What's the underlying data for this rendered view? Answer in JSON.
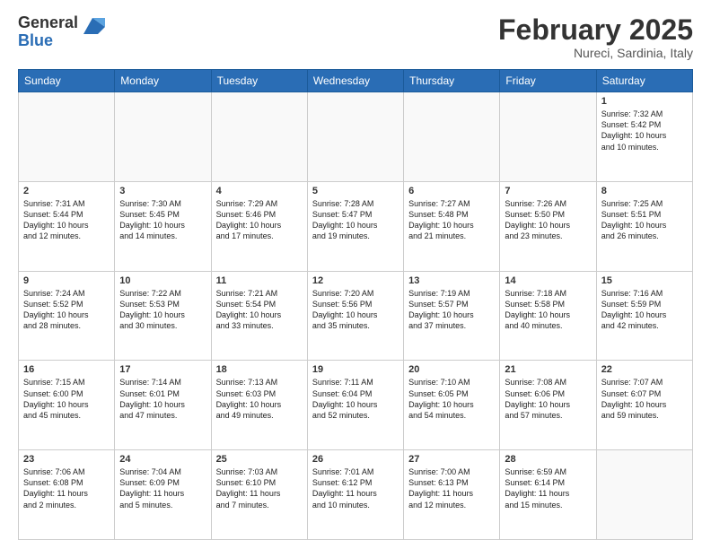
{
  "header": {
    "logo_general": "General",
    "logo_blue": "Blue",
    "month_title": "February 2025",
    "location": "Nureci, Sardinia, Italy"
  },
  "weekdays": [
    "Sunday",
    "Monday",
    "Tuesday",
    "Wednesday",
    "Thursday",
    "Friday",
    "Saturday"
  ],
  "weeks": [
    [
      {
        "day": "",
        "info": ""
      },
      {
        "day": "",
        "info": ""
      },
      {
        "day": "",
        "info": ""
      },
      {
        "day": "",
        "info": ""
      },
      {
        "day": "",
        "info": ""
      },
      {
        "day": "",
        "info": ""
      },
      {
        "day": "1",
        "info": "Sunrise: 7:32 AM\nSunset: 5:42 PM\nDaylight: 10 hours\nand 10 minutes."
      }
    ],
    [
      {
        "day": "2",
        "info": "Sunrise: 7:31 AM\nSunset: 5:44 PM\nDaylight: 10 hours\nand 12 minutes."
      },
      {
        "day": "3",
        "info": "Sunrise: 7:30 AM\nSunset: 5:45 PM\nDaylight: 10 hours\nand 14 minutes."
      },
      {
        "day": "4",
        "info": "Sunrise: 7:29 AM\nSunset: 5:46 PM\nDaylight: 10 hours\nand 17 minutes."
      },
      {
        "day": "5",
        "info": "Sunrise: 7:28 AM\nSunset: 5:47 PM\nDaylight: 10 hours\nand 19 minutes."
      },
      {
        "day": "6",
        "info": "Sunrise: 7:27 AM\nSunset: 5:48 PM\nDaylight: 10 hours\nand 21 minutes."
      },
      {
        "day": "7",
        "info": "Sunrise: 7:26 AM\nSunset: 5:50 PM\nDaylight: 10 hours\nand 23 minutes."
      },
      {
        "day": "8",
        "info": "Sunrise: 7:25 AM\nSunset: 5:51 PM\nDaylight: 10 hours\nand 26 minutes."
      }
    ],
    [
      {
        "day": "9",
        "info": "Sunrise: 7:24 AM\nSunset: 5:52 PM\nDaylight: 10 hours\nand 28 minutes."
      },
      {
        "day": "10",
        "info": "Sunrise: 7:22 AM\nSunset: 5:53 PM\nDaylight: 10 hours\nand 30 minutes."
      },
      {
        "day": "11",
        "info": "Sunrise: 7:21 AM\nSunset: 5:54 PM\nDaylight: 10 hours\nand 33 minutes."
      },
      {
        "day": "12",
        "info": "Sunrise: 7:20 AM\nSunset: 5:56 PM\nDaylight: 10 hours\nand 35 minutes."
      },
      {
        "day": "13",
        "info": "Sunrise: 7:19 AM\nSunset: 5:57 PM\nDaylight: 10 hours\nand 37 minutes."
      },
      {
        "day": "14",
        "info": "Sunrise: 7:18 AM\nSunset: 5:58 PM\nDaylight: 10 hours\nand 40 minutes."
      },
      {
        "day": "15",
        "info": "Sunrise: 7:16 AM\nSunset: 5:59 PM\nDaylight: 10 hours\nand 42 minutes."
      }
    ],
    [
      {
        "day": "16",
        "info": "Sunrise: 7:15 AM\nSunset: 6:00 PM\nDaylight: 10 hours\nand 45 minutes."
      },
      {
        "day": "17",
        "info": "Sunrise: 7:14 AM\nSunset: 6:01 PM\nDaylight: 10 hours\nand 47 minutes."
      },
      {
        "day": "18",
        "info": "Sunrise: 7:13 AM\nSunset: 6:03 PM\nDaylight: 10 hours\nand 49 minutes."
      },
      {
        "day": "19",
        "info": "Sunrise: 7:11 AM\nSunset: 6:04 PM\nDaylight: 10 hours\nand 52 minutes."
      },
      {
        "day": "20",
        "info": "Sunrise: 7:10 AM\nSunset: 6:05 PM\nDaylight: 10 hours\nand 54 minutes."
      },
      {
        "day": "21",
        "info": "Sunrise: 7:08 AM\nSunset: 6:06 PM\nDaylight: 10 hours\nand 57 minutes."
      },
      {
        "day": "22",
        "info": "Sunrise: 7:07 AM\nSunset: 6:07 PM\nDaylight: 10 hours\nand 59 minutes."
      }
    ],
    [
      {
        "day": "23",
        "info": "Sunrise: 7:06 AM\nSunset: 6:08 PM\nDaylight: 11 hours\nand 2 minutes."
      },
      {
        "day": "24",
        "info": "Sunrise: 7:04 AM\nSunset: 6:09 PM\nDaylight: 11 hours\nand 5 minutes."
      },
      {
        "day": "25",
        "info": "Sunrise: 7:03 AM\nSunset: 6:10 PM\nDaylight: 11 hours\nand 7 minutes."
      },
      {
        "day": "26",
        "info": "Sunrise: 7:01 AM\nSunset: 6:12 PM\nDaylight: 11 hours\nand 10 minutes."
      },
      {
        "day": "27",
        "info": "Sunrise: 7:00 AM\nSunset: 6:13 PM\nDaylight: 11 hours\nand 12 minutes."
      },
      {
        "day": "28",
        "info": "Sunrise: 6:59 AM\nSunset: 6:14 PM\nDaylight: 11 hours\nand 15 minutes."
      },
      {
        "day": "",
        "info": ""
      }
    ]
  ]
}
